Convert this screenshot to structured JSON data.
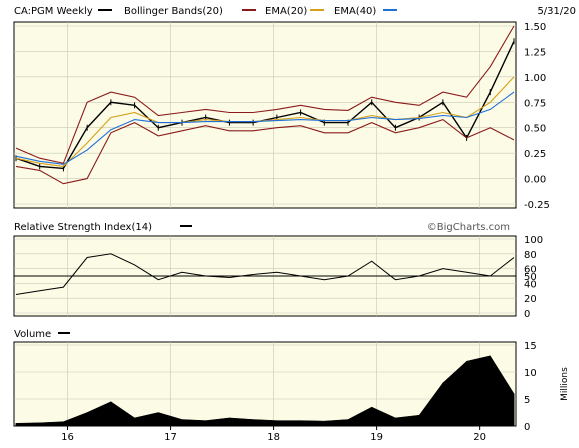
{
  "header": {
    "symbol_label": "CA:PGM Weekly",
    "date": "5/31/20",
    "legend": [
      {
        "label": "Bollinger Bands(20)",
        "color": "#8b1a1a"
      },
      {
        "label": "EMA(20)",
        "color": "#d4a017"
      },
      {
        "label": "EMA(40)",
        "color": "#1e6fd9"
      }
    ],
    "price_color": "#000000"
  },
  "rsi_panel": {
    "title": "Relative Strength Index(14)",
    "watermark": "©BigCharts.com"
  },
  "volume_panel": {
    "title": "Volume",
    "unit_label": "Millions"
  },
  "colors": {
    "background": "#fbfbe6",
    "frame": "#000000",
    "grid": "#c8c8b4"
  },
  "chart_data": [
    {
      "type": "line",
      "name": "price",
      "x": [
        "2015-07",
        "2015-10",
        "2016-01",
        "2016-04",
        "2016-07",
        "2016-10",
        "2017-01",
        "2017-04",
        "2017-07",
        "2017-10",
        "2018-01",
        "2018-04",
        "2018-07",
        "2018-10",
        "2019-01",
        "2019-04",
        "2019-07",
        "2019-10",
        "2020-01",
        "2020-03",
        "2020-04",
        "2020-05"
      ],
      "x_ticks": [
        "16",
        "17",
        "18",
        "19",
        "20"
      ],
      "y_ticks": [
        "1.50",
        "1.25",
        "1.00",
        "0.75",
        "0.50",
        "0.25",
        "0.00",
        "-0.25"
      ],
      "ylim": [
        -0.25,
        1.5
      ],
      "series": [
        {
          "name": "Price",
          "values": [
            0.2,
            0.12,
            0.1,
            0.5,
            0.75,
            0.72,
            0.5,
            0.55,
            0.6,
            0.55,
            0.55,
            0.6,
            0.65,
            0.55,
            0.55,
            0.75,
            0.5,
            0.6,
            0.75,
            0.4,
            0.85,
            1.35
          ]
        },
        {
          "name": "EMA(20)",
          "values": [
            0.2,
            0.15,
            0.12,
            0.35,
            0.6,
            0.65,
            0.55,
            0.55,
            0.58,
            0.56,
            0.56,
            0.58,
            0.6,
            0.57,
            0.57,
            0.62,
            0.58,
            0.6,
            0.65,
            0.6,
            0.75,
            1.0
          ]
        },
        {
          "name": "EMA(40)",
          "values": [
            0.22,
            0.17,
            0.14,
            0.28,
            0.48,
            0.58,
            0.55,
            0.55,
            0.56,
            0.56,
            0.56,
            0.57,
            0.58,
            0.57,
            0.57,
            0.6,
            0.58,
            0.59,
            0.62,
            0.6,
            0.68,
            0.85
          ]
        },
        {
          "name": "Bollinger Upper",
          "values": [
            0.3,
            0.2,
            0.15,
            0.75,
            0.85,
            0.8,
            0.62,
            0.65,
            0.68,
            0.65,
            0.65,
            0.68,
            0.72,
            0.68,
            0.67,
            0.8,
            0.75,
            0.72,
            0.85,
            0.8,
            1.1,
            1.5
          ]
        },
        {
          "name": "Bollinger Lower",
          "values": [
            0.12,
            0.08,
            -0.05,
            0.0,
            0.45,
            0.55,
            0.42,
            0.47,
            0.52,
            0.47,
            0.47,
            0.5,
            0.52,
            0.45,
            0.45,
            0.55,
            0.45,
            0.5,
            0.58,
            0.4,
            0.5,
            0.38
          ]
        }
      ]
    },
    {
      "type": "line",
      "name": "rsi",
      "x": [
        "2015-07",
        "2015-10",
        "2016-01",
        "2016-04",
        "2016-07",
        "2016-10",
        "2017-01",
        "2017-04",
        "2017-07",
        "2017-10",
        "2018-01",
        "2018-04",
        "2018-07",
        "2018-10",
        "2019-01",
        "2019-04",
        "2019-07",
        "2019-10",
        "2020-01",
        "2020-03",
        "2020-04",
        "2020-05"
      ],
      "y_ticks": [
        "100",
        "80",
        "60",
        "50",
        "40",
        "20",
        "0"
      ],
      "reference_line": 50,
      "ylim": [
        0,
        100
      ],
      "values": [
        25,
        30,
        35,
        75,
        80,
        65,
        45,
        55,
        50,
        48,
        52,
        55,
        50,
        45,
        50,
        70,
        45,
        50,
        60,
        55,
        50,
        75
      ]
    },
    {
      "type": "area",
      "name": "volume",
      "x": [
        "2015-07",
        "2015-10",
        "2016-01",
        "2016-04",
        "2016-07",
        "2016-10",
        "2017-01",
        "2017-04",
        "2017-07",
        "2017-10",
        "2018-01",
        "2018-04",
        "2018-07",
        "2018-10",
        "2019-01",
        "2019-04",
        "2019-07",
        "2019-10",
        "2020-01",
        "2020-03",
        "2020-04",
        "2020-05"
      ],
      "y_ticks": [
        "15",
        "10",
        "5",
        "0"
      ],
      "ylim": [
        0,
        15
      ],
      "values": [
        0.5,
        0.6,
        0.8,
        2.5,
        4.5,
        1.5,
        2.5,
        1.2,
        1.0,
        1.5,
        1.2,
        1.0,
        1.0,
        0.9,
        1.2,
        3.5,
        1.5,
        2.0,
        8.0,
        12.0,
        13.0,
        6.0
      ]
    }
  ]
}
